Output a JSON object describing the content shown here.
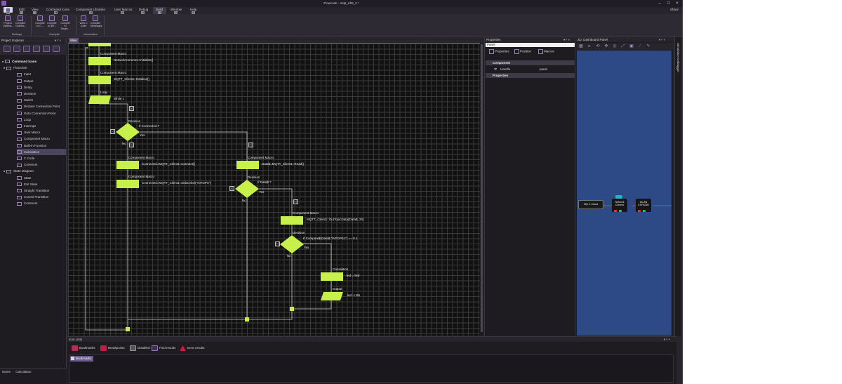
{
  "window": {
    "title": "Flowcode - mqtt_rdt3_2 *",
    "min": "–",
    "max": "□",
    "close": "×"
  },
  "menu": {
    "file_key": "F",
    "items": [
      {
        "label": "Edit",
        "key": "E"
      },
      {
        "label": "View",
        "key": "W"
      },
      {
        "label": "Command Icons",
        "key": "I"
      },
      {
        "label": "Component Libraries",
        "key": "C"
      },
      {
        "label": "User Macros",
        "key": "U"
      },
      {
        "label": "Debug",
        "key": "D"
      },
      {
        "label": "Build",
        "key": "B"
      },
      {
        "label": "Window",
        "key": "N"
      },
      {
        "label": "Help",
        "key": "H"
      }
    ],
    "share": "Share"
  },
  "ribbon": {
    "buttons": [
      {
        "label": "Project Options..."
      },
      {
        "label": "Compiler Options..."
      },
      {
        "label": "Compile to C..."
      },
      {
        "label": "Compile to [BY..."
      },
      {
        "label": "Compile to Target..."
      },
      {
        "label": "View C Code"
      },
      {
        "label": "Compiler Messages"
      }
    ],
    "groups": [
      "Settings",
      "Compile",
      "Information"
    ]
  },
  "project_explorer": {
    "title": "Project Explorer",
    "pin": "▾ ᵖ ×",
    "tree": [
      {
        "label": "Command Icons",
        "level": 0,
        "bold": true
      },
      {
        "label": "Flowchart",
        "level": 1
      },
      {
        "label": "Input",
        "level": 2
      },
      {
        "label": "Output",
        "level": 2
      },
      {
        "label": "Delay",
        "level": 2
      },
      {
        "label": "Decision",
        "level": 2
      },
      {
        "label": "Switch",
        "level": 2
      },
      {
        "label": "Declare Connection Point",
        "level": 2
      },
      {
        "label": "Goto Connection Point",
        "level": 2
      },
      {
        "label": "Loop",
        "level": 2
      },
      {
        "label": "Interrupt",
        "level": 2
      },
      {
        "label": "User Macro",
        "level": 2
      },
      {
        "label": "Component Macro",
        "level": 2
      },
      {
        "label": "Built-in Function",
        "level": 2
      },
      {
        "label": "Calculation",
        "level": 2,
        "selected": true
      },
      {
        "label": "C Code",
        "level": 2
      },
      {
        "label": "Comment",
        "level": 2
      },
      {
        "label": "State Diagram",
        "level": 1
      },
      {
        "label": "State",
        "level": 2
      },
      {
        "label": "Exit State",
        "level": 2
      },
      {
        "label": "Straight Transition",
        "level": 2
      },
      {
        "label": "Curved Transition",
        "level": 2
      },
      {
        "label": "Comment",
        "level": 2
      }
    ],
    "status_name_label": "Name",
    "status_name_value": "Calculation"
  },
  "editor": {
    "tab": "Main",
    "nodes": {
      "cm1_title": "Component Macro",
      "cm1_text": "NetworkComms1::Initialise()",
      "cm2_title": "Component Macro",
      "cm2_text": "MQTT_Client1::Initialise()",
      "loop_title": "Loop",
      "loop_text": "While 1",
      "dec1_title": "Decision",
      "dec1_text": "If Connected ?",
      "dec1_yes": "Yes",
      "dec1_no": "No",
      "cm3_title": "Component Macro",
      "cm3_text": "Connected=MQTT_Client1::Connect()",
      "cm4_title": "Component Macro",
      "cm4_text": "Connected=MQTT_Client1::Subscribe(\"INTOPS\")",
      "cm5_title": "Component Macro",
      "cm5_text": "Data$=MQTT_Client1::Read()",
      "dec2_title": "Decision",
      "dec2_text": "If Data$ ?",
      "dec2_yes": "Yes",
      "dec2_no": "No",
      "cm6_title": "Component Macro",
      "cm6_text": "MQTT_Client1::OutTopicData(Data$, 20)",
      "dec3_title": "Decision",
      "dec3_text": "If Compare$(Data$,\"INTOPE1\") == 0 1",
      "dec3_yes": "Yes",
      "dec3_no": "No",
      "calc_title": "Calculation",
      "calc_text": "led = !led",
      "out_title": "Output",
      "out_text": "led -> B5",
      "collapse": "[-]"
    }
  },
  "properties": {
    "title": "Properties",
    "pin": "▾ ᵖ ×",
    "search": "Panel",
    "tabs": [
      "Properties",
      "Position",
      "Macros"
    ],
    "sections": [
      {
        "label": "Component"
      },
      {
        "label": "Properties"
      }
    ],
    "rows": [
      {
        "name": "Handle",
        "value": "panel"
      }
    ]
  },
  "dashboard": {
    "title": "2D: Dashboard Panel",
    "pin": "▾ ᵖ ×",
    "components": [
      {
        "label": "MQ: 1 Cloud"
      },
      {
        "label": "Network Comms"
      },
      {
        "label": "WLAN ESP8266"
      }
    ]
  },
  "side_tab": {
    "label": "Simulation Debugger"
  },
  "icon_lists": {
    "title": "Icon Lists",
    "pin": "▾ ᵖ ×",
    "tabs": [
      "Bookmarks",
      "Breakpoints",
      "Disabled",
      "Find results",
      "Error results"
    ],
    "chip": "Bookmarks"
  },
  "colors": {
    "node": "#c7f04a",
    "accent": "#8a5bb0",
    "canvas": "#111111",
    "dashboard": "#2d4a87"
  }
}
